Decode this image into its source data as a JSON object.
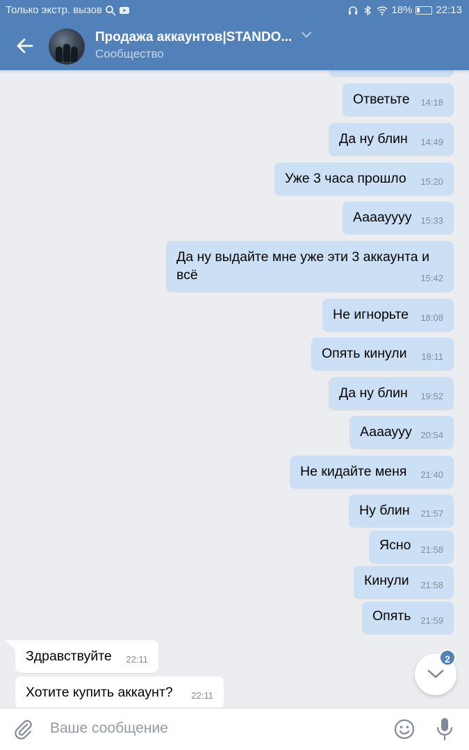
{
  "status_bar": {
    "carrier": "Только экстр. вызов",
    "battery": "18%",
    "time": "22:13"
  },
  "header": {
    "title": "Продажа аккаунтов|STANDO...",
    "subtitle": "Сообщество"
  },
  "messages": [
    {
      "dir": "out",
      "text": "Ответьте",
      "time": "14:18"
    },
    {
      "dir": "out",
      "text": "Да ну блин",
      "time": "14:49"
    },
    {
      "dir": "out",
      "text": "Уже 3 часа прошло",
      "time": "15:20"
    },
    {
      "dir": "out",
      "text": "Аааауууу",
      "time": "15:33"
    },
    {
      "dir": "out",
      "text": "Да ну выдайте мне уже эти 3 аккаунта и всё",
      "time": "15:42"
    },
    {
      "dir": "out",
      "text": "Не игнорьте",
      "time": "18:08"
    },
    {
      "dir": "out",
      "text": "Опять кинули",
      "time": "18:11"
    },
    {
      "dir": "out",
      "text": "Да ну блин",
      "time": "19:52"
    },
    {
      "dir": "out",
      "text": "Аааауyy",
      "time": "20:54"
    },
    {
      "dir": "out",
      "text": "Не кидайте меня",
      "time": "21:40"
    },
    {
      "dir": "out",
      "text": "Ну блин",
      "time": "21:57"
    },
    {
      "dir": "out",
      "text": "Ясно",
      "time": "21:58"
    },
    {
      "dir": "out",
      "text": "Кинули",
      "time": "21:58"
    },
    {
      "dir": "out",
      "text": "Опять",
      "time": "21:59"
    },
    {
      "dir": "in",
      "text": "Здравствуйте",
      "time": "22:11"
    },
    {
      "dir": "in",
      "text": "Хотите купить аккаунт?",
      "time": "22:11"
    }
  ],
  "scroll_down": {
    "unread_count": "2"
  },
  "composer": {
    "placeholder": "Ваше сообщение"
  },
  "colors": {
    "header": "#5181b8",
    "outgoing_bubble": "#cce0f5",
    "incoming_bubble": "#ffffff",
    "background": "#ebedf0"
  }
}
